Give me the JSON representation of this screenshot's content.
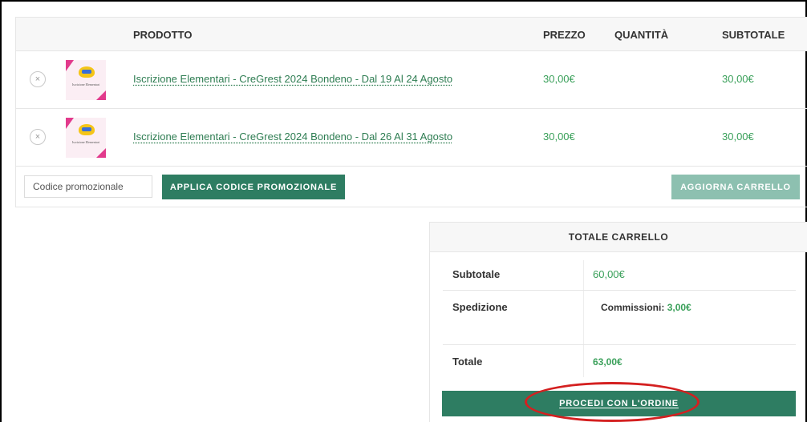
{
  "cart": {
    "headers": {
      "product": "PRODOTTO",
      "price": "PREZZO",
      "quantity": "QUANTITÀ",
      "subtotal": "SUBTOTALE"
    },
    "items": [
      {
        "name": "Iscrizione Elementari - CreGrest 2024 Bondeno - Dal 19 Al 24 Agosto",
        "price": "30,00€",
        "subtotal": "30,00€",
        "remove_icon": "×",
        "thumb_caption": "Iscrizione Elementari",
        "thumb_logo": "CREGREST"
      },
      {
        "name": "Iscrizione Elementari - CreGrest 2024 Bondeno - Dal 26 Al 31 Agosto",
        "price": "30,00€",
        "subtotal": "30,00€",
        "remove_icon": "×",
        "thumb_caption": "Iscrizione Elementari",
        "thumb_logo": "CREGREST"
      }
    ],
    "coupon_placeholder": "Codice promozionale",
    "apply_label": "APPLICA CODICE PROMOZIONALE",
    "update_label": "AGGIORNA CARRELLO"
  },
  "totals": {
    "title": "TOTALE CARRELLO",
    "subtotal_label": "Subtotale",
    "subtotal_value": "60,00€",
    "shipping_label": "Spedizione",
    "shipping_fee_label": "Commissioni:",
    "shipping_fee_value": "3,00€",
    "total_label": "Totale",
    "total_value": "63,00€",
    "checkout_label": "PROCEDI CON L'ORDINE"
  },
  "colors": {
    "primary_button": "#2e7d62",
    "disabled_button": "#8dc0b0",
    "price_green": "#3aa05a",
    "annotation_red": "#d42020"
  },
  "icons": {
    "remove": "close-icon"
  }
}
